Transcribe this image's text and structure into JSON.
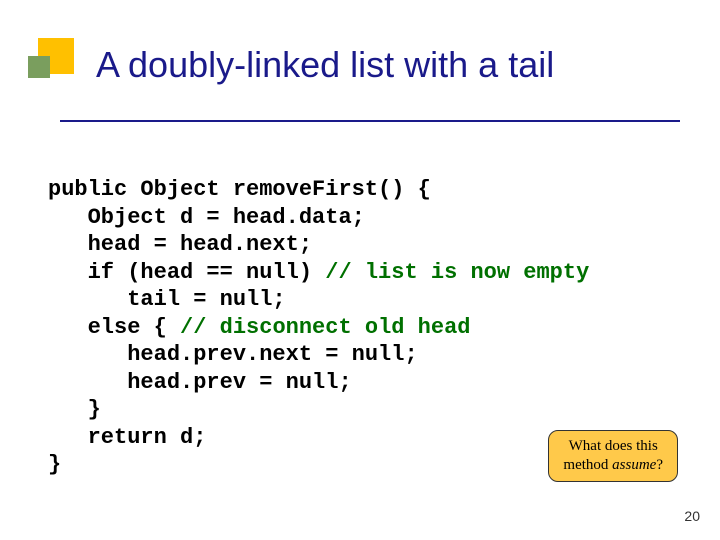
{
  "title": "A doubly-linked list with a tail",
  "code": {
    "l1": "public Object removeFirst() {",
    "l2": "   Object d = head.data;",
    "l3": "   head = head.next;",
    "l4a": "   if (head == null) ",
    "l4b": "// list is now empty",
    "l5": "      tail = null;",
    "l6a": "   else { ",
    "l6b": "// disconnect old head",
    "l7": "      head.prev.next = null;",
    "l8": "      head.prev = null;",
    "l9": "   }",
    "l10": "   return d;",
    "l11": "}"
  },
  "callout": {
    "line1": "What does this",
    "line2_a": "method ",
    "line2_b": "assume",
    "line2_c": "?"
  },
  "page_number": "20"
}
